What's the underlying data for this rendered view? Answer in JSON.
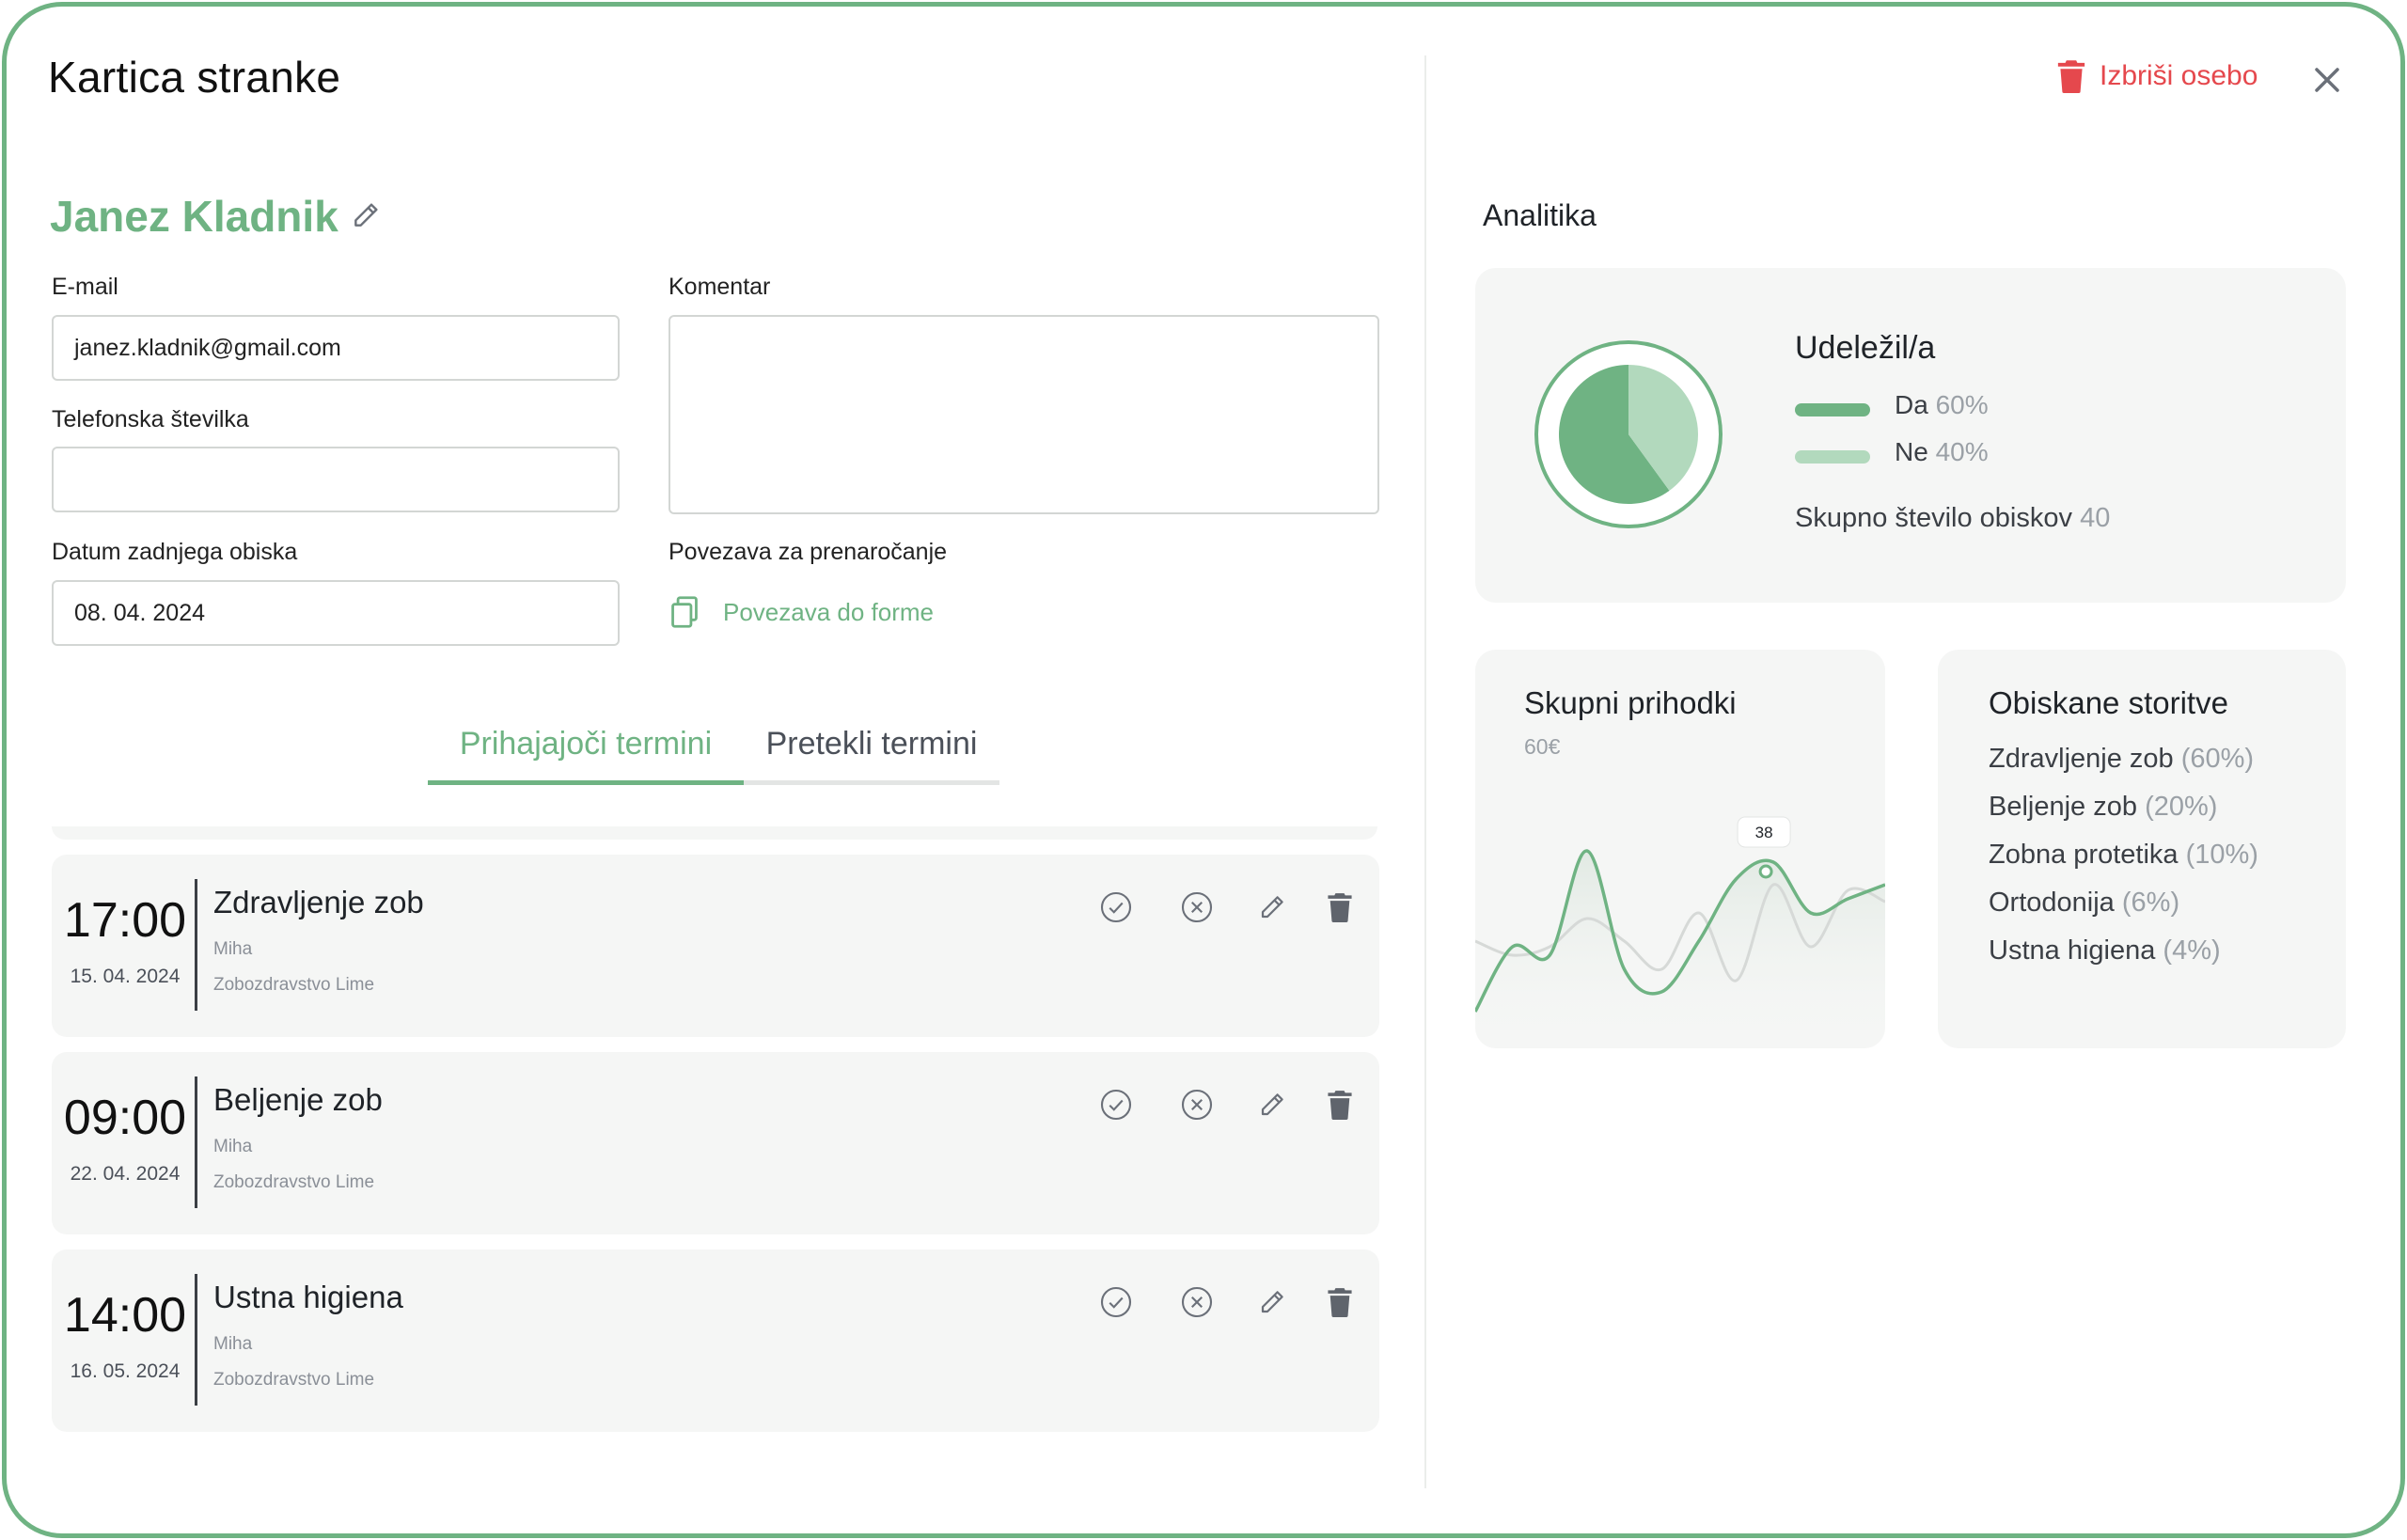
{
  "header": {
    "title": "Kartica stranke",
    "delete_label": "Izbriši osebo"
  },
  "client": {
    "name": "Janez Kladnik",
    "fields": {
      "email_label": "E-mail",
      "email_value": "janez.kladnik@gmail.com",
      "phone_label": "Telefonska številka",
      "phone_value": "",
      "last_visit_label": "Datum zadnjega obiska",
      "last_visit_value": "08. 04. 2024",
      "comment_label": "Komentar",
      "comment_value": "",
      "rebooking_label": "Povezava za prenaročanje",
      "rebooking_link": "Povezava do forme"
    }
  },
  "tabs": [
    {
      "label": "Prihajajoči termini",
      "active": true
    },
    {
      "label": "Pretekli termini",
      "active": false
    }
  ],
  "appointments": [
    {
      "time": "17:00",
      "date": "15. 04. 2024",
      "service": "Zdravljenje zob",
      "staff": "Miha",
      "location": "Zobozdravstvo Lime"
    },
    {
      "time": "09:00",
      "date": "22. 04. 2024",
      "service": "Beljenje zob",
      "staff": "Miha",
      "location": "Zobozdravstvo Lime"
    },
    {
      "time": "14:00",
      "date": "16. 05. 2024",
      "service": "Ustna higiena",
      "staff": "Miha",
      "location": "Zobozdravstvo Lime"
    }
  ],
  "analytics": {
    "title": "Analitika",
    "attendance": {
      "title": "Udeležil/a",
      "yes_label": "Da",
      "yes_value": "60%",
      "no_label": "Ne",
      "no_value": "40%",
      "total_label": "Skupno število obiskov",
      "total_value": "40"
    },
    "revenue": {
      "title": "Skupni prihodki",
      "value": "60€",
      "tooltip": "38"
    },
    "services": {
      "title": "Obiskane storitve",
      "items": [
        {
          "name": "Zdravljenje zob",
          "pct": "(60%)"
        },
        {
          "name": "Beljenje zob",
          "pct": "(20%)"
        },
        {
          "name": "Zobna protetika",
          "pct": "(10%)"
        },
        {
          "name": "Ortodonija",
          "pct": "(6%)"
        },
        {
          "name": "Ustna higiena",
          "pct": "(4%)"
        }
      ]
    }
  },
  "chart_data": [
    {
      "type": "pie",
      "title": "Udeležil/a",
      "labels": [
        "Da",
        "Ne"
      ],
      "values": [
        60,
        40
      ],
      "colors": [
        "#6fb383",
        "#b2d9bd"
      ]
    },
    {
      "type": "line",
      "title": "Skupni prihodki",
      "x": [
        0,
        1,
        2,
        3,
        4,
        5,
        6,
        7,
        8,
        9,
        10,
        11
      ],
      "series": [
        {
          "values": [
            5,
            28,
            25,
            62,
            20,
            12,
            30,
            52,
            58,
            40,
            45,
            50
          ]
        },
        {
          "values": [
            30,
            25,
            28,
            38,
            30,
            20,
            40,
            16,
            50,
            28,
            48,
            44
          ]
        }
      ],
      "colors": [
        "#6fb383",
        "#d6d9d7"
      ],
      "annotations": [
        {
          "text": "38"
        }
      ]
    }
  ],
  "colors": {
    "accent": "#6fb383",
    "accent_light": "#b2d9bd",
    "danger": "#e5484d",
    "card_bg": "#f5f6f5"
  },
  "icons": {
    "delete": "trash-icon",
    "close": "close-icon",
    "edit": "pencil-icon",
    "copy": "copy-icon",
    "confirm": "check-circle-icon",
    "cancel": "x-circle-icon"
  }
}
